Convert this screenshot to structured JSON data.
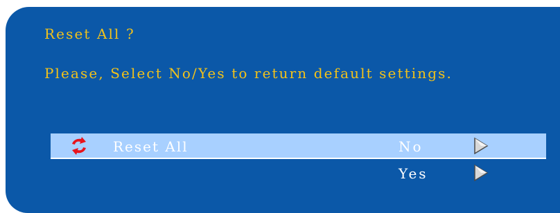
{
  "dialog": {
    "title": "Reset All ?",
    "message": "Please, Select No/Yes to return default settings."
  },
  "menu": {
    "rows": [
      {
        "label": "Reset All",
        "value": "No",
        "icon": "reset-icon",
        "selected": true
      },
      {
        "label": "",
        "value": "Yes",
        "icon": "",
        "selected": false
      }
    ]
  },
  "colors": {
    "panel_background": "#0b58a8",
    "prompt_text": "#f2c21a",
    "selected_row_background": "#a8d0ff",
    "item_text": "#ffffff",
    "icon_red": "#e8141c"
  },
  "icons": {
    "reset": "reset-icon",
    "arrow": "arrow-right-icon"
  }
}
